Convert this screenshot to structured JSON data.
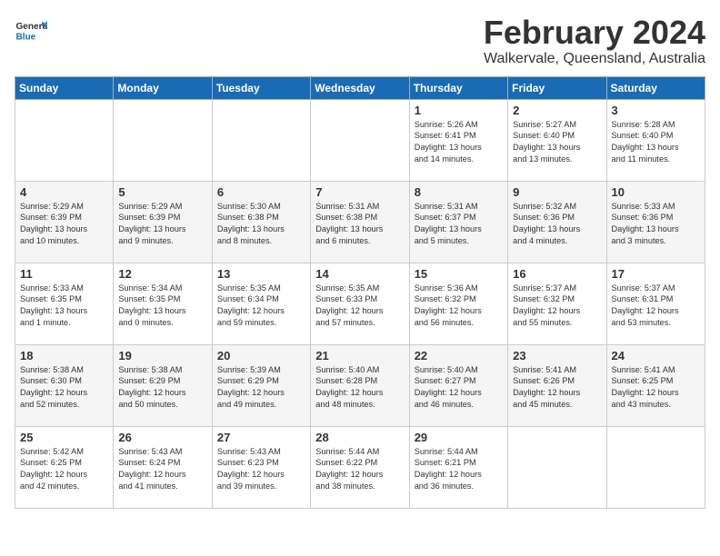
{
  "logo": {
    "text_general": "General",
    "text_blue": "Blue"
  },
  "header": {
    "title": "February 2024",
    "subtitle": "Walkervale, Queensland, Australia"
  },
  "days_of_week": [
    "Sunday",
    "Monday",
    "Tuesday",
    "Wednesday",
    "Thursday",
    "Friday",
    "Saturday"
  ],
  "weeks": [
    [
      {
        "day": "",
        "info": ""
      },
      {
        "day": "",
        "info": ""
      },
      {
        "day": "",
        "info": ""
      },
      {
        "day": "",
        "info": ""
      },
      {
        "day": "1",
        "info": "Sunrise: 5:26 AM\nSunset: 6:41 PM\nDaylight: 13 hours\nand 14 minutes."
      },
      {
        "day": "2",
        "info": "Sunrise: 5:27 AM\nSunset: 6:40 PM\nDaylight: 13 hours\nand 13 minutes."
      },
      {
        "day": "3",
        "info": "Sunrise: 5:28 AM\nSunset: 6:40 PM\nDaylight: 13 hours\nand 11 minutes."
      }
    ],
    [
      {
        "day": "4",
        "info": "Sunrise: 5:29 AM\nSunset: 6:39 PM\nDaylight: 13 hours\nand 10 minutes."
      },
      {
        "day": "5",
        "info": "Sunrise: 5:29 AM\nSunset: 6:39 PM\nDaylight: 13 hours\nand 9 minutes."
      },
      {
        "day": "6",
        "info": "Sunrise: 5:30 AM\nSunset: 6:38 PM\nDaylight: 13 hours\nand 8 minutes."
      },
      {
        "day": "7",
        "info": "Sunrise: 5:31 AM\nSunset: 6:38 PM\nDaylight: 13 hours\nand 6 minutes."
      },
      {
        "day": "8",
        "info": "Sunrise: 5:31 AM\nSunset: 6:37 PM\nDaylight: 13 hours\nand 5 minutes."
      },
      {
        "day": "9",
        "info": "Sunrise: 5:32 AM\nSunset: 6:36 PM\nDaylight: 13 hours\nand 4 minutes."
      },
      {
        "day": "10",
        "info": "Sunrise: 5:33 AM\nSunset: 6:36 PM\nDaylight: 13 hours\nand 3 minutes."
      }
    ],
    [
      {
        "day": "11",
        "info": "Sunrise: 5:33 AM\nSunset: 6:35 PM\nDaylight: 13 hours\nand 1 minute."
      },
      {
        "day": "12",
        "info": "Sunrise: 5:34 AM\nSunset: 6:35 PM\nDaylight: 13 hours\nand 0 minutes."
      },
      {
        "day": "13",
        "info": "Sunrise: 5:35 AM\nSunset: 6:34 PM\nDaylight: 12 hours\nand 59 minutes."
      },
      {
        "day": "14",
        "info": "Sunrise: 5:35 AM\nSunset: 6:33 PM\nDaylight: 12 hours\nand 57 minutes."
      },
      {
        "day": "15",
        "info": "Sunrise: 5:36 AM\nSunset: 6:32 PM\nDaylight: 12 hours\nand 56 minutes."
      },
      {
        "day": "16",
        "info": "Sunrise: 5:37 AM\nSunset: 6:32 PM\nDaylight: 12 hours\nand 55 minutes."
      },
      {
        "day": "17",
        "info": "Sunrise: 5:37 AM\nSunset: 6:31 PM\nDaylight: 12 hours\nand 53 minutes."
      }
    ],
    [
      {
        "day": "18",
        "info": "Sunrise: 5:38 AM\nSunset: 6:30 PM\nDaylight: 12 hours\nand 52 minutes."
      },
      {
        "day": "19",
        "info": "Sunrise: 5:38 AM\nSunset: 6:29 PM\nDaylight: 12 hours\nand 50 minutes."
      },
      {
        "day": "20",
        "info": "Sunrise: 5:39 AM\nSunset: 6:29 PM\nDaylight: 12 hours\nand 49 minutes."
      },
      {
        "day": "21",
        "info": "Sunrise: 5:40 AM\nSunset: 6:28 PM\nDaylight: 12 hours\nand 48 minutes."
      },
      {
        "day": "22",
        "info": "Sunrise: 5:40 AM\nSunset: 6:27 PM\nDaylight: 12 hours\nand 46 minutes."
      },
      {
        "day": "23",
        "info": "Sunrise: 5:41 AM\nSunset: 6:26 PM\nDaylight: 12 hours\nand 45 minutes."
      },
      {
        "day": "24",
        "info": "Sunrise: 5:41 AM\nSunset: 6:25 PM\nDaylight: 12 hours\nand 43 minutes."
      }
    ],
    [
      {
        "day": "25",
        "info": "Sunrise: 5:42 AM\nSunset: 6:25 PM\nDaylight: 12 hours\nand 42 minutes."
      },
      {
        "day": "26",
        "info": "Sunrise: 5:43 AM\nSunset: 6:24 PM\nDaylight: 12 hours\nand 41 minutes."
      },
      {
        "day": "27",
        "info": "Sunrise: 5:43 AM\nSunset: 6:23 PM\nDaylight: 12 hours\nand 39 minutes."
      },
      {
        "day": "28",
        "info": "Sunrise: 5:44 AM\nSunset: 6:22 PM\nDaylight: 12 hours\nand 38 minutes."
      },
      {
        "day": "29",
        "info": "Sunrise: 5:44 AM\nSunset: 6:21 PM\nDaylight: 12 hours\nand 36 minutes."
      },
      {
        "day": "",
        "info": ""
      },
      {
        "day": "",
        "info": ""
      }
    ]
  ]
}
